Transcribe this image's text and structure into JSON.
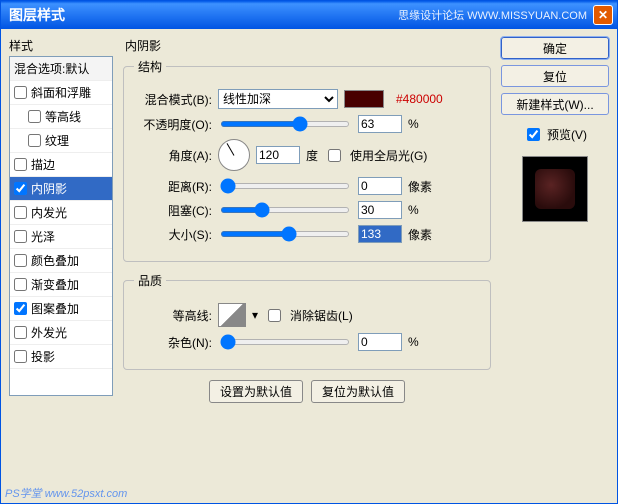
{
  "window": {
    "title": "图层样式",
    "brand": "思缘设计论坛 WWW.MISSYUAN.COM"
  },
  "list": {
    "styles_label": "样式",
    "blend_label": "混合选项:默认",
    "items": [
      {
        "label": "斜面和浮雕",
        "checked": false
      },
      {
        "label": "等高线",
        "checked": false,
        "indent": true
      },
      {
        "label": "纹理",
        "checked": false,
        "indent": true
      },
      {
        "label": "描边",
        "checked": false
      },
      {
        "label": "内阴影",
        "checked": true,
        "selected": true
      },
      {
        "label": "内发光",
        "checked": false
      },
      {
        "label": "光泽",
        "checked": false
      },
      {
        "label": "颜色叠加",
        "checked": false
      },
      {
        "label": "渐变叠加",
        "checked": false
      },
      {
        "label": "图案叠加",
        "checked": true
      },
      {
        "label": "外发光",
        "checked": false
      },
      {
        "label": "投影",
        "checked": false
      }
    ]
  },
  "panel": {
    "title": "内阴影",
    "structure_legend": "结构",
    "quality_legend": "品质",
    "blend_mode_label": "混合模式(B):",
    "blend_mode_value": "线性加深",
    "color_hex": "#480000",
    "opacity_label": "不透明度(O):",
    "opacity_value": "63",
    "percent": "%",
    "angle_label": "角度(A):",
    "angle_value": "120",
    "degree": "度",
    "global_light_label": "使用全局光(G)",
    "distance_label": "距离(R):",
    "distance_value": "0",
    "pixels": "像素",
    "choke_label": "阻塞(C):",
    "choke_value": "30",
    "size_label": "大小(S):",
    "size_value": "133",
    "contour_label": "等高线:",
    "antialias_label": "消除锯齿(L)",
    "noise_label": "杂色(N):",
    "noise_value": "0",
    "make_default": "设置为默认值",
    "reset_default": "复位为默认值"
  },
  "buttons": {
    "ok": "确定",
    "cancel": "复位",
    "new_style": "新建样式(W)...",
    "preview": "预览(V)"
  },
  "footer": "PS学堂 www.52psxt.com"
}
